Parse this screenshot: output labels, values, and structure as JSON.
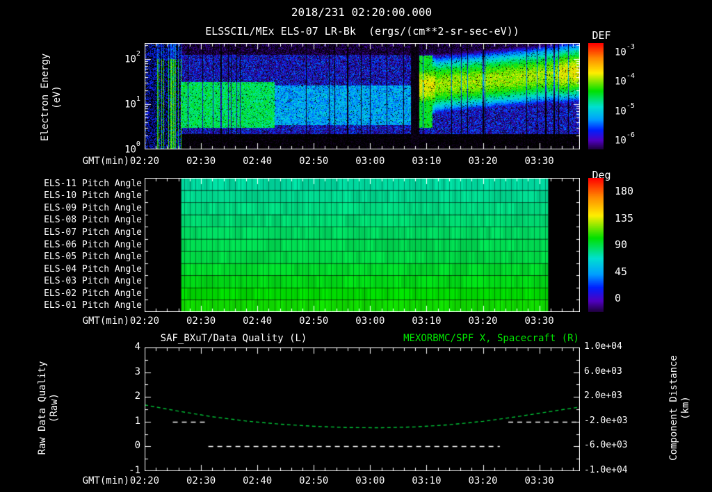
{
  "header": {
    "title": "2018/231 02:20:00.000"
  },
  "colors": {
    "background": "#000000",
    "text": "#ffffff",
    "title_green": "#00e800",
    "spacecraft_curve_green": "#00c838",
    "quality_line_white": "#ffffff",
    "colormap": [
      [
        0,
        "#ff0000"
      ],
      [
        0.14,
        "#ff8800"
      ],
      [
        0.28,
        "#ffee00"
      ],
      [
        0.45,
        "#00e000"
      ],
      [
        0.6,
        "#00e0d0"
      ],
      [
        0.72,
        "#00a0ff"
      ],
      [
        0.82,
        "#0020ff"
      ],
      [
        0.92,
        "#5000c0"
      ],
      [
        1,
        "#200040"
      ]
    ]
  },
  "chart_data": [
    {
      "type": "heatmap",
      "id": "electron-energy-spectrogram",
      "title": "ELSSCIL/MEx ELS-07 LR-Bk  (ergs/(cm**2-sr-sec-eV))",
      "xlabel": "GMT(min)",
      "x_ticks": [
        "02:20",
        "02:30",
        "02:40",
        "02:50",
        "03:00",
        "03:10",
        "03:20",
        "03:30"
      ],
      "x_tick_minutes": [
        140,
        150,
        160,
        170,
        180,
        190,
        200,
        210
      ],
      "x_range_minutes": [
        140,
        217.2
      ],
      "ylabel_lines": [
        "Electron Energy",
        "(eV)"
      ],
      "y_scale": "log",
      "y_range_eV": [
        1,
        224
      ],
      "y_tick_labels": [
        "10^2",
        "10^1",
        "10^0"
      ],
      "y_tick_values": [
        100,
        10,
        1
      ],
      "colorbar": {
        "label": "DEF",
        "tick_labels": [
          "10^-3",
          "10^-4",
          "10^-5",
          "10^-6"
        ],
        "tick_log_values": [
          -3,
          -4,
          -5,
          -6
        ],
        "log_range": [
          -2.7,
          -6.3
        ]
      },
      "features": [
        {
          "name": "calibration-stripes",
          "t_minutes": [
            140,
            146.5
          ],
          "energy_eV": [
            1.5,
            200
          ],
          "log_flux": -4.3,
          "desc": "bright green vertical stripes on black"
        },
        {
          "name": "low-energy-green-patch",
          "t_minutes": [
            146.5,
            163
          ],
          "energy_eV": [
            3,
            32
          ],
          "log_flux": -4.55
        },
        {
          "name": "diffuse-blue-background",
          "t_minutes": [
            146.5,
            217.2
          ],
          "energy_eV": [
            1,
            224
          ],
          "log_flux": -5.85
        },
        {
          "name": "weak-low-energy-haze",
          "t_minutes": [
            163,
            188
          ],
          "energy_eV": [
            3.5,
            26
          ],
          "log_flux": -5.2
        },
        {
          "name": "data-gap",
          "t_minutes": [
            187.2,
            188.6
          ],
          "energy_eV": [
            1,
            224
          ],
          "log_flux": -7
        },
        {
          "name": "energized-band",
          "t_minutes": [
            188.6,
            217.2
          ],
          "energy_eV": [
            15,
            110
          ],
          "log_flux": -3.9,
          "desc": "bright yellow-green band, centre energy rising ~25 to ~55 eV"
        }
      ]
    },
    {
      "type": "heatmap",
      "id": "pitch-angle-panels",
      "xlabel": "GMT(min)",
      "x_ticks": [
        "02:20",
        "02:30",
        "02:40",
        "02:50",
        "03:00",
        "03:10",
        "03:20",
        "03:30"
      ],
      "x_tick_minutes": [
        140,
        150,
        160,
        170,
        180,
        190,
        200,
        210
      ],
      "x_range_minutes": [
        140,
        217.2
      ],
      "coverage_minutes": [
        146.5,
        211.5
      ],
      "rows": [
        {
          "label": "ELS-11 Pitch Angle",
          "mean_deg": 78
        },
        {
          "label": "ELS-10 Pitch Angle",
          "mean_deg": 80
        },
        {
          "label": "ELS-09 Pitch Angle",
          "mean_deg": 82
        },
        {
          "label": "ELS-08 Pitch Angle",
          "mean_deg": 84
        },
        {
          "label": "ELS-07 Pitch Angle",
          "mean_deg": 86
        },
        {
          "label": "ELS-06 Pitch Angle",
          "mean_deg": 88
        },
        {
          "label": "ELS-05 Pitch Angle",
          "mean_deg": 90
        },
        {
          "label": "ELS-04 Pitch Angle",
          "mean_deg": 93
        },
        {
          "label": "ELS-03 Pitch Angle",
          "mean_deg": 96
        },
        {
          "label": "ELS-02 Pitch Angle",
          "mean_deg": 99
        },
        {
          "label": "ELS-01 Pitch Angle",
          "mean_deg": 101
        }
      ],
      "colorbar": {
        "label": "Deg",
        "ticks": [
          180,
          135,
          90,
          45,
          0
        ],
        "range_deg": [
          0,
          180
        ]
      }
    },
    {
      "type": "line",
      "id": "quality-and-spacecraft-distance",
      "title_left": "SAF_BXuT/Data Quality (L)",
      "title_right": "MEXORBMC/SPF X, Spacecraft (R)",
      "xlabel": "GMT(min)",
      "x_ticks": [
        "02:20",
        "02:30",
        "02:40",
        "02:50",
        "03:00",
        "03:10",
        "03:20",
        "03:30"
      ],
      "x_tick_minutes": [
        140,
        150,
        160,
        170,
        180,
        190,
        200,
        210
      ],
      "x_range_minutes": [
        140,
        217.2
      ],
      "ylabel_left_lines": [
        "Raw Data Quality",
        "(Raw)"
      ],
      "ylabel_right_lines": [
        "Component Distance",
        "(km)"
      ],
      "y_left_range": [
        -1,
        4
      ],
      "y_left_ticks": [
        4,
        3,
        2,
        1,
        0,
        -1
      ],
      "y_right_range": [
        -10000,
        10000
      ],
      "y_right_tick_labels": [
        "1.0e+04",
        "6.0e+03",
        "2.0e+03",
        "-2.0e+03",
        "-6.0e+03",
        "-1.0e+04"
      ],
      "series": [
        {
          "name": "Raw Data Quality (L)",
          "axis": "left",
          "style": "dashed-white",
          "segments": [
            {
              "value": 1,
              "t_minutes": [
                145,
                150.7
              ]
            },
            {
              "value": 0,
              "t_minutes": [
                151.3,
                203
              ]
            },
            {
              "value": 1,
              "t_minutes": [
                204.5,
                216.7
              ]
            }
          ]
        },
        {
          "name": "Spacecraft X (R)",
          "axis": "right",
          "style": "dashed-green",
          "points_t_km": [
            [
              140,
              700
            ],
            [
              146,
              -300
            ],
            [
              152,
              -1200
            ],
            [
              158,
              -1900
            ],
            [
              164,
              -2400
            ],
            [
              170,
              -2750
            ],
            [
              176,
              -2950
            ],
            [
              182,
              -2980
            ],
            [
              188,
              -2850
            ],
            [
              194,
              -2500
            ],
            [
              200,
              -1950
            ],
            [
              206,
              -1200
            ],
            [
              212,
              -350
            ],
            [
              216.7,
              300
            ]
          ]
        }
      ]
    }
  ]
}
